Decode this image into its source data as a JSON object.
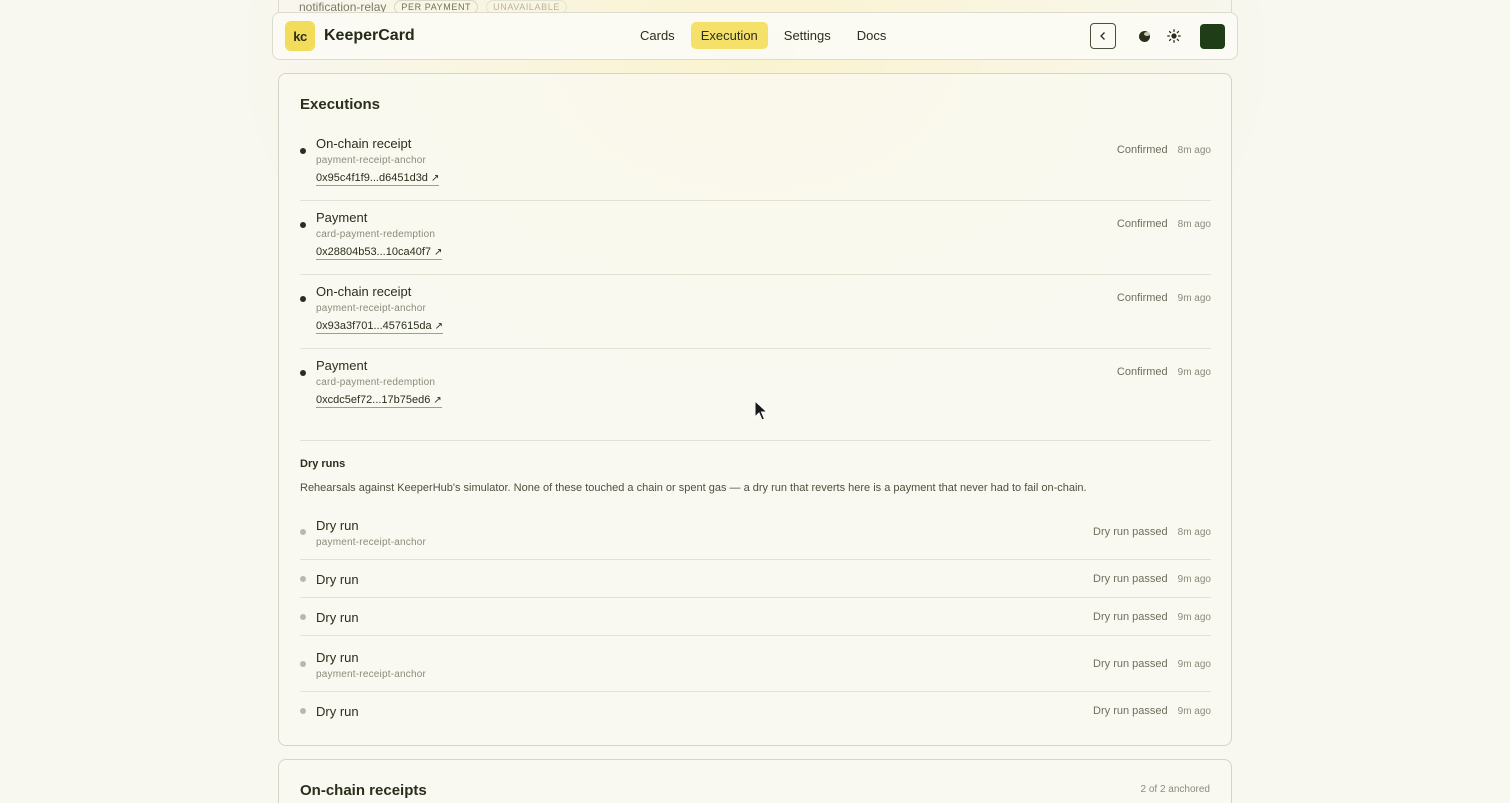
{
  "peek_row": {
    "name": "notification-relay",
    "tag_pricing": "PER PAYMENT",
    "tag_status": "UNAVAILABLE"
  },
  "nav": {
    "logo_text": "kc",
    "brand": "KeeperCard",
    "tabs": [
      {
        "label": "Cards"
      },
      {
        "label": "Execution",
        "active": true
      },
      {
        "label": "Settings"
      },
      {
        "label": "Docs"
      }
    ],
    "icons": [
      "chevron-left-icon",
      "moon-icon",
      "sun-icon",
      "avatar"
    ]
  },
  "executions": {
    "title": "Executions",
    "items": [
      {
        "title": "On-chain receipt",
        "workflow": "payment-receipt-anchor",
        "hash": "0x95c4f1f9...d6451d3d",
        "status": "Confirmed",
        "ago": "8m ago"
      },
      {
        "title": "Payment",
        "workflow": "card-payment-redemption",
        "hash": "0x28804b53...10ca40f7",
        "status": "Confirmed",
        "ago": "8m ago"
      },
      {
        "title": "On-chain receipt",
        "workflow": "payment-receipt-anchor",
        "hash": "0x93a3f701...457615da",
        "status": "Confirmed",
        "ago": "9m ago"
      },
      {
        "title": "Payment",
        "workflow": "card-payment-redemption",
        "hash": "0xcdc5ef72...17b75ed6",
        "status": "Confirmed",
        "ago": "9m ago"
      }
    ]
  },
  "dry_runs": {
    "title": "Dry runs",
    "description": "Rehearsals against KeeperHub's simulator. None of these touched a chain or spent gas — a dry run that reverts here is a payment that never had to fail on-chain.",
    "items": [
      {
        "title": "Dry run",
        "workflow": "payment-receipt-anchor",
        "status": "Dry run passed",
        "ago": "8m ago"
      },
      {
        "title": "Dry run",
        "workflow": "",
        "status": "Dry run passed",
        "ago": "9m ago"
      },
      {
        "title": "Dry run",
        "workflow": "",
        "status": "Dry run passed",
        "ago": "9m ago"
      },
      {
        "title": "Dry run",
        "workflow": "payment-receipt-anchor",
        "status": "Dry run passed",
        "ago": "9m ago"
      },
      {
        "title": "Dry run",
        "workflow": "",
        "status": "Dry run passed",
        "ago": "9m ago"
      }
    ]
  },
  "receipts": {
    "title": "On-chain receipts",
    "count": "2 of 2 anchored"
  },
  "colors": {
    "accent": "#f5e06a",
    "text": "#2a2f1c",
    "muted": "#8a8c7a",
    "avatar": "#1f3d16"
  }
}
